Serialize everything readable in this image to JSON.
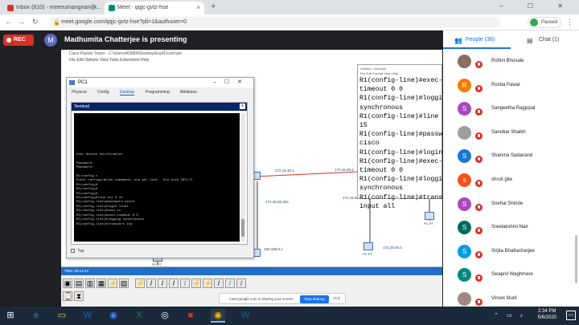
{
  "browser": {
    "tabs": [
      {
        "label": "Inbox (810) - meenumangnan@...",
        "color": "#d93025"
      },
      {
        "label": "Meet - qqjc-gvtz-hse",
        "color": "#00897b"
      }
    ],
    "new_tab": "+",
    "window_controls": "– ☐ ✕",
    "url": "meet.google.com/qqjc-gvtz-hse?pli=1&authuser=0",
    "profile_status": "Paused"
  },
  "meet": {
    "rec_label": "REC",
    "presenter_initial": "M",
    "presenting_text": "Madhumita Chatterjee is presenting"
  },
  "packet_tracer": {
    "window_title": "Cisco Packet Tracer - C:\\Users\\ADMIN\\Desktop\\ExpR1conf.pkt",
    "menu": "File  Edit  Options  View  Tools  Extensions  Help",
    "pc_window_title": "PC1",
    "pc_tabs": [
      "Physical",
      "Config",
      "Desktop",
      "Programming",
      "Attributes"
    ],
    "pc_selected_tab": "Desktop",
    "terminal_title": "Terminal",
    "terminal_lines": [
      "User Access Verification",
      "",
      "Password: ",
      "Password:",
      "",
      "R1>config t",
      "Enter configuration commands, one per line.  End with CNTL/Z.",
      "R1(config)#",
      "R1(config)#",
      "R1(config)#",
      "R1(config)#line vty 0 15",
      "R1(config-line)#password cisco",
      "R1(config-line)#login local",
      "R1(config-line)#exec-ti",
      "R1(config-line)#exec-timeout 0 0",
      "R1(config-line)#logging synchronous",
      "R1(config-line)#transport inp"
    ],
    "top_checkbox_label": "Top",
    "notepad_title": "Untitled - Notepad",
    "notepad_menu": "File  Edit  Format  View  Help",
    "notepad_lines": [
      "R1(config-line)#exec-",
      "timeout 0 0",
      "R1(config-line)#loggi",
      "synchronous",
      "R1(config-line)#line",
      "15",
      "R1(config-line)#passw",
      "cisco",
      "R1(config-line)#login",
      "R1(config-line)#exec-",
      "timeout 0 0",
      "R1(config-line)#loggi",
      "synchronous",
      "R1(config-line)#trans",
      "input all"
    ],
    "net_labels": {
      "l1": "172.16.30.1",
      "l2": "172.16.30.2",
      "l3": "172.16.20.254",
      "l4": "172.16.40.1",
      "l5": "172.16.10.2",
      "l6": "192.168.0.1",
      "l7": "172.16.40.3",
      "pc_a": "PC-PT",
      "pc_b": "PC-PT",
      "pc_c": "PC-PT"
    },
    "status_strip": "Time: 00:12:24",
    "share_text": "meet.google.com is sharing your screen.",
    "stop_sharing": "Stop sharing",
    "hide": "Hide"
  },
  "panel": {
    "people_tab": "People (38)",
    "chat_tab": "Chat (1)",
    "participants": [
      {
        "name": "Rohini Bhosale",
        "initial": "",
        "color": "#8d6e63"
      },
      {
        "name": "Ronita Pawar",
        "initial": "R",
        "color": "#f57c00"
      },
      {
        "name": "Sangeetha Rajgopal",
        "initial": "S",
        "color": "#ab47bc"
      },
      {
        "name": "Sanobar Shaikh",
        "initial": "",
        "color": "#9e9e9e"
      },
      {
        "name": "Sharvna Sadanand",
        "initial": "S",
        "color": "#1976d2"
      },
      {
        "name": "shruti gite",
        "initial": "s",
        "color": "#f4511e"
      },
      {
        "name": "Snehal Shinde",
        "initial": "S",
        "color": "#ab47bc"
      },
      {
        "name": "Sreelakshmi Nair",
        "initial": "S",
        "color": "#00695c"
      },
      {
        "name": "Srijita Bhattacharjee",
        "initial": "S",
        "color": "#039be5"
      },
      {
        "name": "Swapnil Waghmare",
        "initial": "S",
        "color": "#00897b"
      },
      {
        "name": "Vinoot Murli",
        "initial": "",
        "color": "#a1887f"
      }
    ]
  },
  "taskbar": {
    "time": "2:34 PM",
    "date": "5/6/2020"
  }
}
